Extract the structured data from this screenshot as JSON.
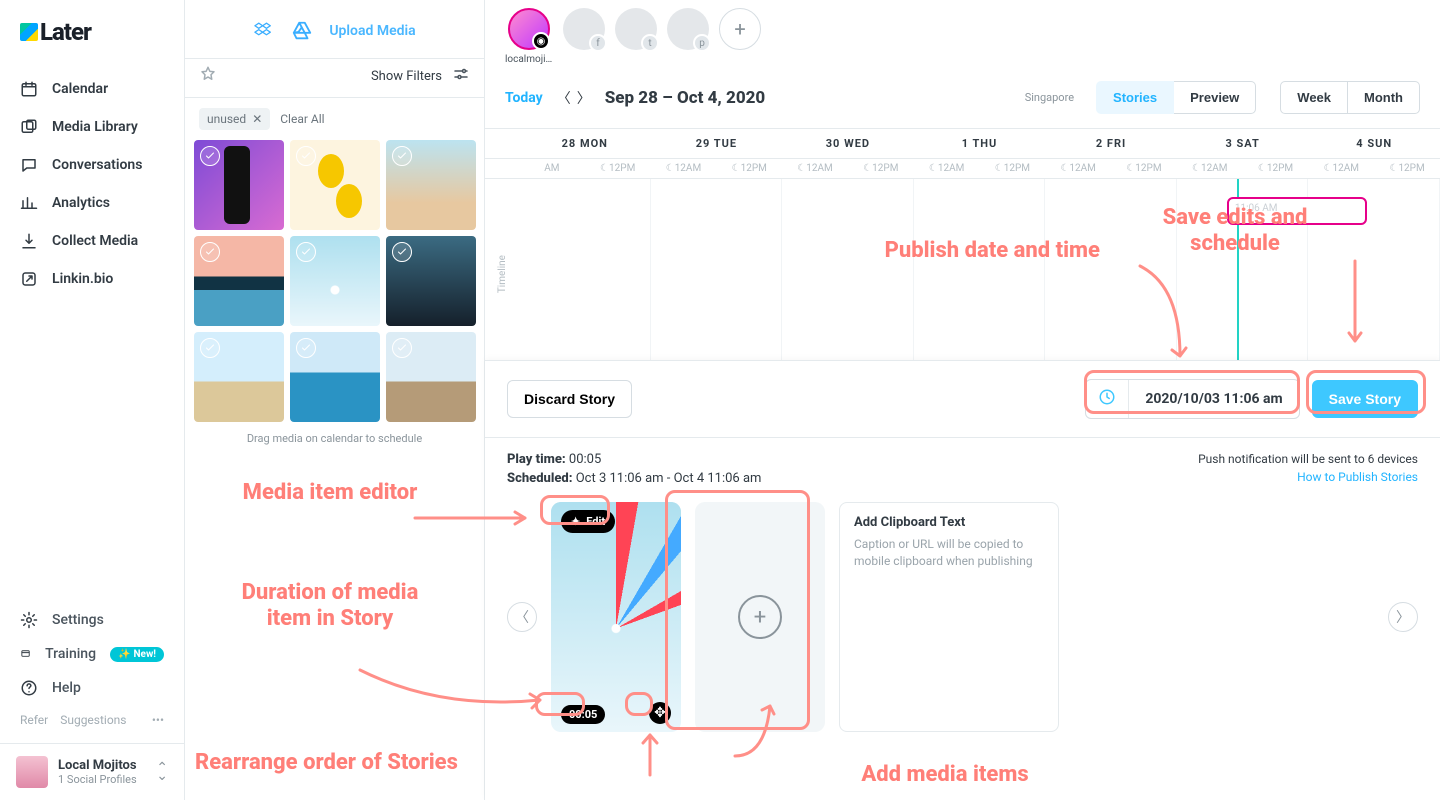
{
  "brand": "Later",
  "nav": {
    "items": [
      {
        "label": "Calendar"
      },
      {
        "label": "Media Library"
      },
      {
        "label": "Conversations"
      },
      {
        "label": "Analytics"
      },
      {
        "label": "Collect Media"
      },
      {
        "label": "Linkin.bio"
      }
    ],
    "bottom": {
      "settings": "Settings",
      "training": "Training",
      "training_badge": "New!",
      "help": "Help",
      "refer": "Refer",
      "suggestions": "Suggestions"
    },
    "account": {
      "name": "Local Mojitos",
      "sub": "1 Social Profiles"
    }
  },
  "media": {
    "upload_label": "Upload Media",
    "show_filters": "Show Filters",
    "tag": "unused",
    "clear_all": "Clear All",
    "drag_hint": "Drag media on calendar to schedule"
  },
  "profiles": {
    "active_label": "localmojit..."
  },
  "calendar": {
    "today": "Today",
    "range": "Sep 28 – Oct 4, 2020",
    "tz": "Singapore",
    "views": {
      "stories": "Stories",
      "preview": "Preview",
      "week": "Week",
      "month": "Month"
    },
    "days": [
      "28 MON",
      "29 TUE",
      "30 WED",
      "1 THU",
      "2 FRI",
      "3 SAT",
      "4 SUN"
    ],
    "time_cols": {
      "am": "AM",
      "noon": "12PM",
      "midnight": "12AM"
    },
    "timeline": "Timeline",
    "event_time": "11:06 AM"
  },
  "editor": {
    "discard": "Discard Story",
    "datetime": "2020/10/03 11:06 am",
    "save": "Save Story",
    "play_label": "Play time:",
    "play_val": "00:05",
    "sched_label": "Scheduled:",
    "sched_val": "Oct 3 11:06 am - Oct 4 11:06 am",
    "push_note": "Push notification will be sent to 6 devices",
    "howto": "How to Publish Stories",
    "edit": "Edit",
    "duration": "00:05",
    "clip_title": "Add Clipboard Text",
    "clip_sub": "Caption or URL will be copied to mobile clipboard when publishing"
  },
  "annotations": {
    "media_editor": "Media item editor",
    "duration": "Duration of media item in Story",
    "reorder": "Rearrange order of Stories",
    "add_media": "Add media items",
    "pub_dt": "Publish date and time",
    "save_sched": "Save edits and schedule"
  }
}
